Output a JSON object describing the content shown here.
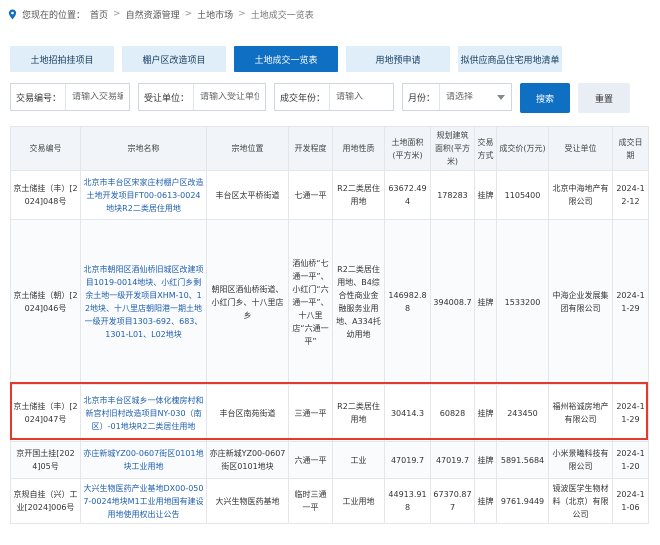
{
  "breadcrumb": {
    "prefix": "您现在的位置：",
    "items": [
      "首页",
      "自然资源管理",
      "土地市场",
      "土地成交一览表"
    ],
    "separator": ">"
  },
  "tabs": [
    {
      "label": "土地招拍挂项目",
      "active": false
    },
    {
      "label": "棚户区改造项目",
      "active": false
    },
    {
      "label": "土地成交一览表",
      "active": true
    },
    {
      "label": "用地预申请",
      "active": false
    },
    {
      "label": "拟供应商品住宅用地清单",
      "active": false
    }
  ],
  "filters": {
    "deal_no": {
      "label": "交易编号：",
      "placeholder": "请输入交易编号"
    },
    "buyer": {
      "label": "受让单位：",
      "placeholder": "请输入受让单位"
    },
    "year": {
      "label": "成交年份：",
      "placeholder": "请输入"
    },
    "month": {
      "label": "月份：",
      "placeholder": "请选择"
    },
    "search_label": "搜索",
    "reset_label": "重置"
  },
  "table": {
    "headers": [
      "交易编号",
      "宗地名称",
      "宗地位置",
      "开发程度",
      "用地性质",
      "土地面积(平方米)",
      "规划建筑面积(平方米)",
      "交易方式",
      "成交价(万元)",
      "受让单位",
      "成交日期"
    ],
    "rows": [
      [
        "京土储挂（丰）[2024]048号",
        "北京市丰台区宋家庄村棚户区改造土地开发项目FT00-0613-0024地块R2二类居住用地",
        "丰台区太平桥街道",
        "七通一平",
        "R2二类居住用地",
        "63672.494",
        "178283",
        "挂牌",
        "1105400",
        "北京中海地产有限公司",
        "2024-12-12"
      ],
      [
        "京土储挂（朝）[2024]046号",
        "北京市朝阳区酒仙桥旧城区改建项目1019-0014地块、小红门乡剩余土地一级开发项目XHM-10、12地块、十八里店朝阳港一期土地一级开发项目1303-692、683、1301-L01、L02地块",
        "朝阳区酒仙桥街道、小红门乡、十八里店乡",
        "酒仙桥“七通一平”、小红门“六通一平”、十八里店“六通一平”",
        "R2二类居住用地、B4综合性商业金融服务业用地、A334托幼用地",
        "146982.88",
        "394008.7",
        "挂牌",
        "1533200",
        "中海企业发展集团有限公司",
        "2024-11-29"
      ],
      [
        "京土储挂（丰）[2024]047号",
        "北京市丰台区城乡一体化槐房村和新宫村旧村改造项目NY-030（南区）-01地块R2二类居住用地",
        "丰台区南苑街道",
        "三通一平",
        "R2二类居住用地",
        "30414.3",
        "60828",
        "挂牌",
        "243450",
        "福州裕诚房地产有限公司",
        "2024-11-29"
      ],
      [
        "京开国土挂[2024]05号",
        "亦庄新城YZ00-0607街区0101地块工业用地",
        "亦庄新城YZ00-0607街区0101地块",
        "六通一平",
        "工业",
        "47019.7",
        "47019.7",
        "挂牌",
        "5891.5684",
        "小米景曦科技有限公司",
        "2024-11-20"
      ],
      [
        "京规自挂（兴）工业[2024]006号",
        "大兴生物医药产业基地DX00-0507-0024地块M1工业用地国有建设用地使用权出让公告",
        "大兴生物医药基地",
        "临时三通一平",
        "工业用地",
        "44913.918",
        "67370.877",
        "挂牌",
        "9761.9449",
        "镜波医学生物材料（北京）有限公司",
        "2024-11-06"
      ]
    ]
  },
  "highlighted_row": 2,
  "colors": {
    "accent": "#0f6fc2",
    "link": "#1f5fae",
    "highlight": "#e23a2c"
  }
}
